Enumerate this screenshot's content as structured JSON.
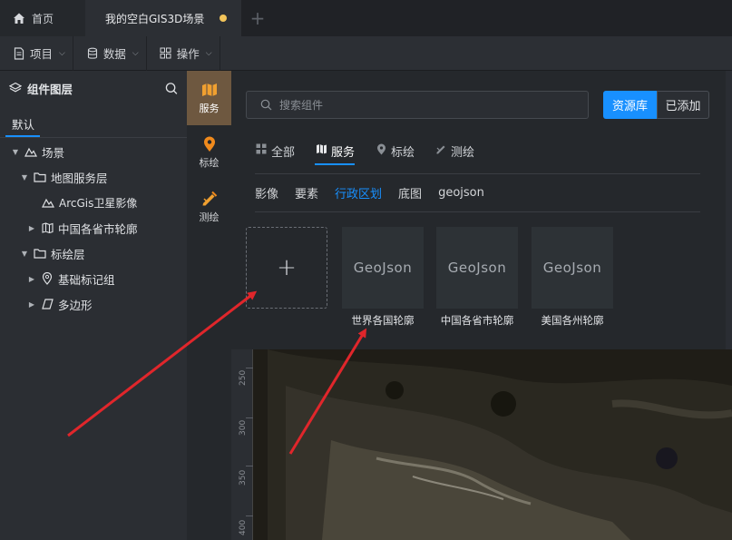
{
  "tabs": {
    "home": "首页",
    "scene": "我的空白GIS3D场景"
  },
  "toolbar": {
    "project": "项目",
    "data": "数据",
    "operate": "操作"
  },
  "layers_panel": {
    "title": "组件图层",
    "tab": "默认",
    "tree": {
      "scene": "场景",
      "map_service_layer": "地图服务层",
      "arcgis": "ArcGis卫星影像",
      "china_provinces": "中国各省市轮廓",
      "annotation_layer": "标绘层",
      "basic_marker_group": "基础标记组",
      "polygon": "多边形"
    }
  },
  "side_strip": {
    "service": "服务",
    "annotate": "标绘",
    "measure": "测绘"
  },
  "library": {
    "search_placeholder": "搜索组件",
    "btn_library": "资源库",
    "btn_added": "已添加",
    "categories": {
      "all": "全部",
      "service": "服务",
      "annotate": "标绘",
      "measure": "测绘"
    },
    "subtypes": {
      "image": "影像",
      "feature": "要素",
      "admin": "行政区划",
      "basemap": "底图",
      "geojson": "geojson"
    },
    "add_symbol": "+",
    "cards": [
      {
        "thumb": "GeoJson",
        "caption": "世界各国轮廓"
      },
      {
        "thumb": "GeoJson",
        "caption": "中国各省市轮廓"
      },
      {
        "thumb": "GeoJson",
        "caption": "美国各州轮廓"
      }
    ]
  },
  "ruler_ticks": [
    "250",
    "300",
    "350",
    "400"
  ],
  "colors": {
    "accent": "#1890ff",
    "annotation_arrow": "#e0262b",
    "active_strip": "#6e5840"
  }
}
